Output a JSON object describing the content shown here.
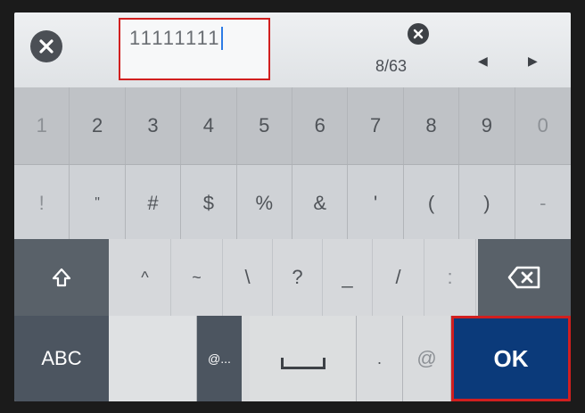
{
  "input": {
    "value": "11111111"
  },
  "counter": "8/63",
  "row1": [
    "1",
    "2",
    "3",
    "4",
    "5",
    "6",
    "7",
    "8",
    "9",
    "0"
  ],
  "row2": [
    "!",
    "\"",
    "#",
    "$",
    "%",
    "&",
    "'",
    "(",
    ")",
    "-"
  ],
  "row3": [
    "^",
    "~",
    "\\",
    "?",
    "_",
    "/",
    ":"
  ],
  "row4": {
    "abc_label": "ABC",
    "at_dots_label": "@...",
    "dot_label": ".",
    "at_label": "@",
    "ok_label": "OK"
  },
  "colors": {
    "highlight": "#d11f1f",
    "ok_background": "#0b3a7a",
    "dark_key": "#4c5560"
  },
  "icons": {
    "cancel": "close-circle-icon",
    "clear": "clear-circle-icon",
    "left": "left-arrow-icon",
    "right": "right-arrow-icon",
    "shift": "shift-up-icon",
    "backspace": "backspace-icon",
    "space": "space-icon"
  }
}
